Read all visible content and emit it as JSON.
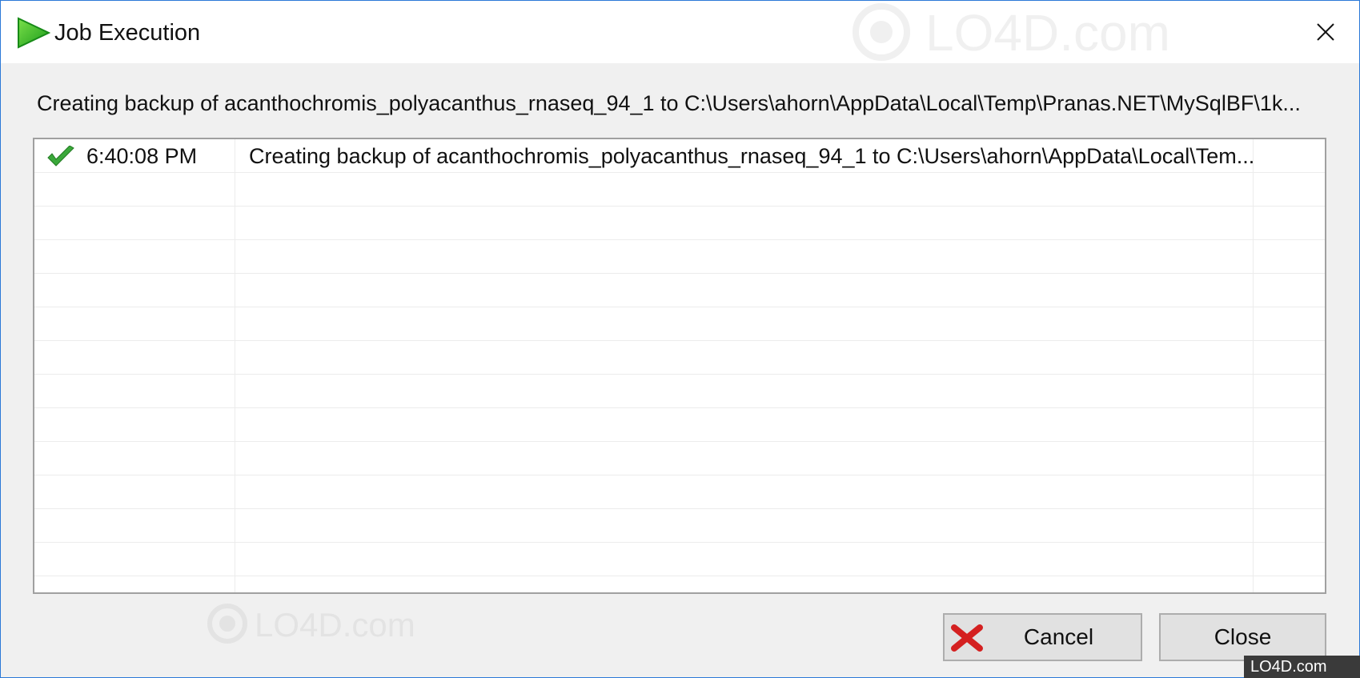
{
  "window": {
    "title": "Job Execution",
    "close_glyph": "✕",
    "icon": "green-play-icon"
  },
  "status": {
    "text": "Creating backup of acanthochromis_polyacanthus_rnaseq_94_1 to C:\\Users\\ahorn\\AppData\\Local\\Temp\\Pranas.NET\\MySqlBF\\1k..."
  },
  "log": {
    "rows": [
      {
        "status_icon": "check-icon",
        "time": "6:40:08 PM",
        "message": "Creating backup of acanthochromis_polyacanthus_rnaseq_94_1 to C:\\Users\\ahorn\\AppData\\Local\\Tem..."
      }
    ],
    "empty_rows": 12
  },
  "buttons": {
    "cancel_label": "Cancel",
    "close_label": "Close"
  },
  "watermark": {
    "text": "LO4D.com"
  },
  "colors": {
    "accent_border": "#2b79d7",
    "check_green": "#3aa83a",
    "cancel_red": "#d42020"
  }
}
